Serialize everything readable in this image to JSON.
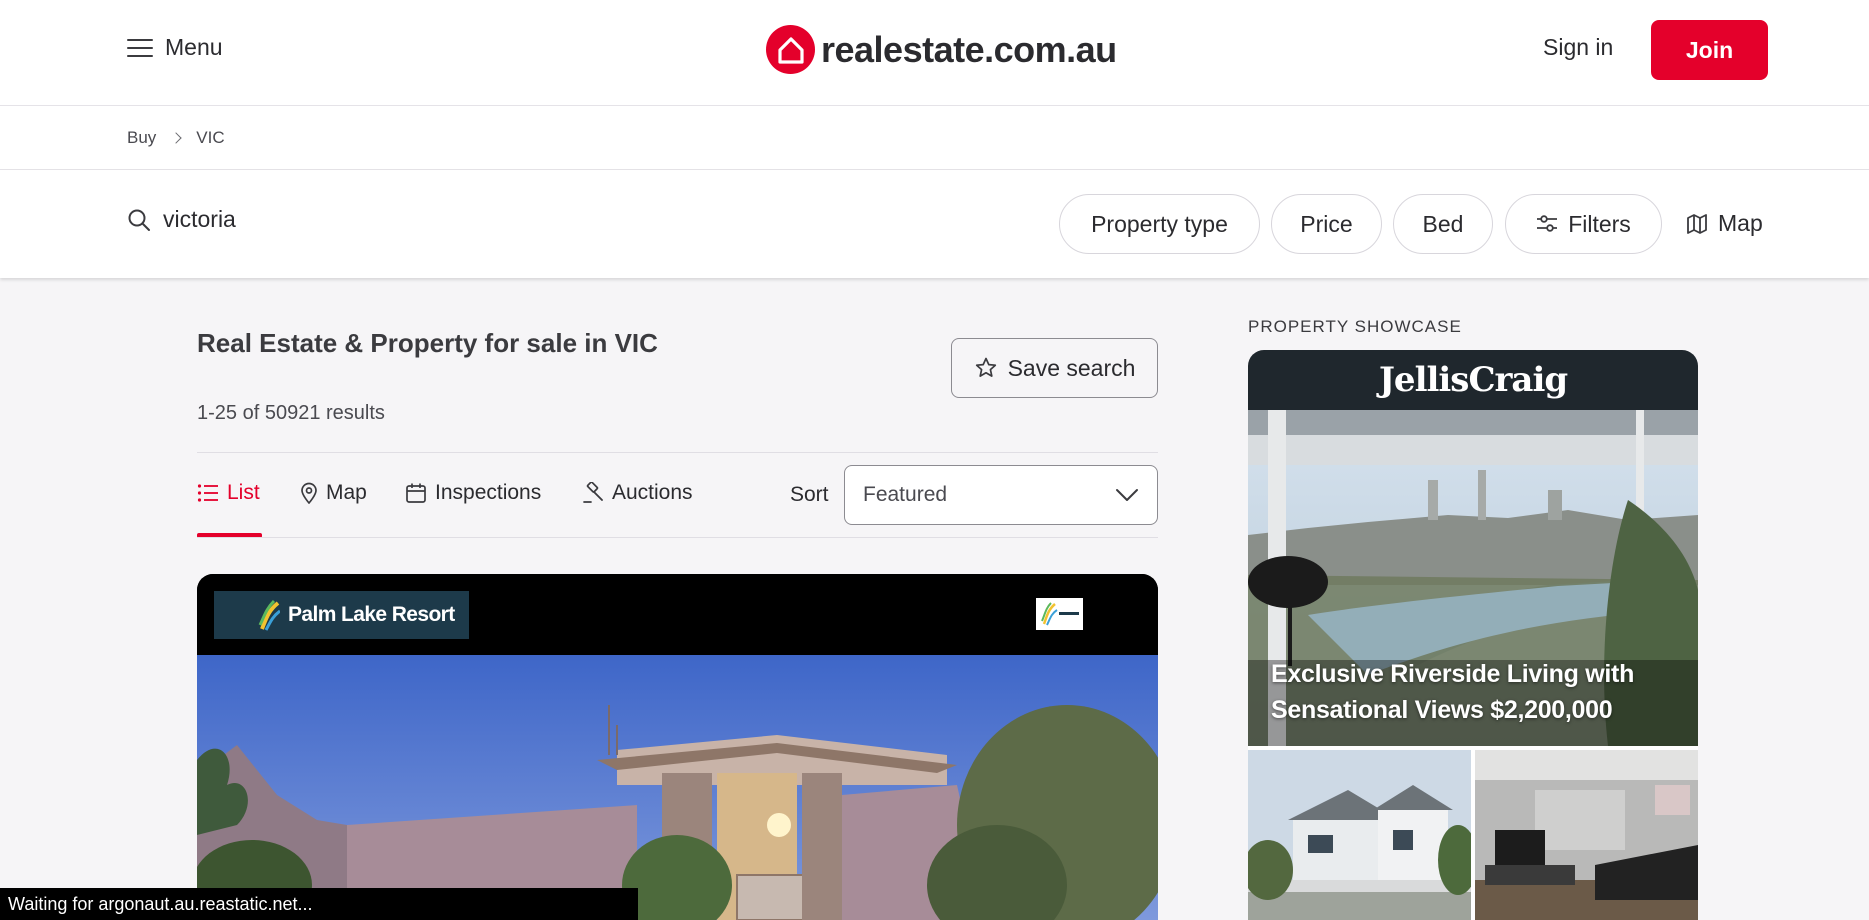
{
  "header": {
    "menu_label": "Menu",
    "logo_text": "realestate.com.au",
    "signin_label": "Sign in",
    "join_label": "Join",
    "brand_color": "#e4002b"
  },
  "breadcrumb": {
    "items": [
      "Buy",
      "VIC"
    ]
  },
  "search": {
    "query": "victoria",
    "filters": [
      "Property type",
      "Price",
      "Bed",
      "Filters"
    ],
    "map_label": "Map"
  },
  "results": {
    "title": "Real Estate & Property for sale in VIC",
    "count": "1-25 of 50921 results",
    "save_search_label": "Save search",
    "tabs": [
      "List",
      "Map",
      "Inspections",
      "Auctions"
    ],
    "active_tab": "List",
    "sort_label": "Sort",
    "sort_value": "Featured"
  },
  "listing": {
    "agency_name": "Palm Lake Resort"
  },
  "showcase": {
    "section_title": "PROPERTY SHOWCASE",
    "agency_name": "JellisCraig",
    "headline": "Exclusive Riverside Living with Sensational Views $2,200,000"
  },
  "status_bar": {
    "text": "Waiting for argonaut.au.reastatic.net..."
  }
}
